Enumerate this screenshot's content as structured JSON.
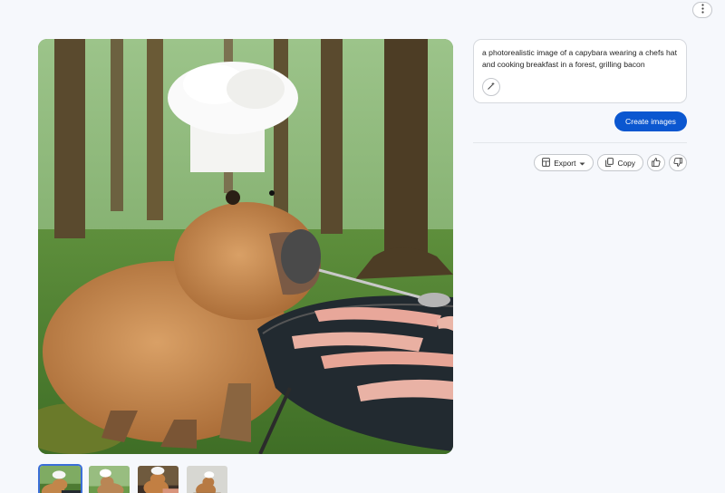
{
  "prompt": {
    "text": "a photorealistic image of a capybara wearing a chefs hat and cooking breakfast in a forest, grilling bacon"
  },
  "buttons": {
    "create_label": "Create images",
    "export_label": "Export",
    "copy_label": "Copy"
  },
  "icons": {
    "more": "more-vert-icon",
    "wand": "magic-wand-icon",
    "export": "sheets-icon",
    "dropdown": "caret-down-icon",
    "copy": "copy-icon",
    "thumb_up": "thumb-up-icon",
    "thumb_down": "thumb-down-icon"
  },
  "gallery": {
    "selected_index": 0,
    "thumbnail_count": 4
  },
  "colors": {
    "accent": "#0b57d0",
    "background": "#f6f8fc",
    "selected_border": "#3b6fd8"
  }
}
